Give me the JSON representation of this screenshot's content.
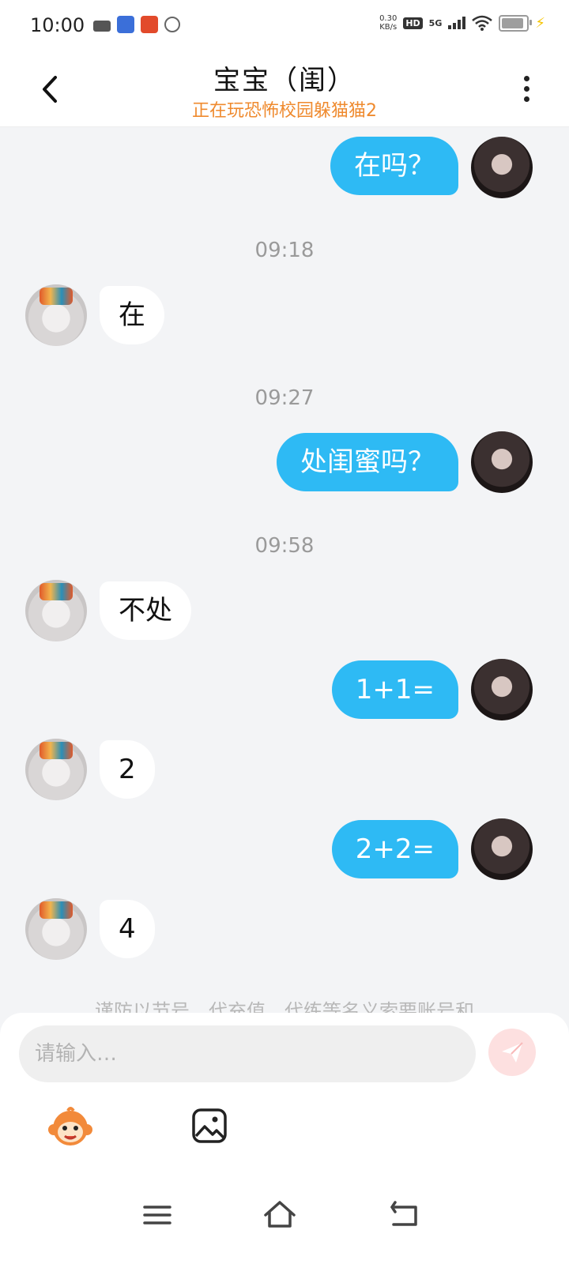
{
  "status_bar": {
    "time": "10:00",
    "net_speed_value": "0.30",
    "net_speed_unit": "KB/s",
    "hd_label": "HD",
    "network_label": "5G",
    "battery_level": 0.9,
    "battery_color": "#9e9e9e"
  },
  "header": {
    "title": "宝宝（闺）",
    "subtitle": "正在玩恐怖校园躲猫猫2",
    "subtitle_color": "#ef8a2e"
  },
  "messages": [
    {
      "side": "me",
      "text": "在吗？"
    },
    {
      "type": "time",
      "text": "09:18"
    },
    {
      "side": "peer",
      "text": "在"
    },
    {
      "type": "time",
      "text": "09:27"
    },
    {
      "side": "me",
      "text": "处闺蜜吗？"
    },
    {
      "type": "time",
      "text": "09:58"
    },
    {
      "side": "peer",
      "text": "不处"
    },
    {
      "side": "me",
      "text": "1+1="
    },
    {
      "side": "peer",
      "text": "2"
    },
    {
      "side": "me",
      "text": "2+2="
    },
    {
      "side": "peer",
      "text": "4"
    }
  ],
  "notice": "谨防以节号、代充值、代练等名义索要账号和",
  "input": {
    "placeholder": "请输入…"
  },
  "colors": {
    "my_bubble": "#2ebaf4",
    "peer_bubble": "#ffffff",
    "background": "#f3f4f6"
  },
  "icons": {
    "back": "chevron-left-icon",
    "more": "more-vertical-icon",
    "send": "send-icon",
    "emoji": "monkey-emoji-icon",
    "image": "image-icon",
    "nav_menu": "menu-icon",
    "nav_home": "home-icon",
    "nav_back": "back-arrow-icon"
  }
}
